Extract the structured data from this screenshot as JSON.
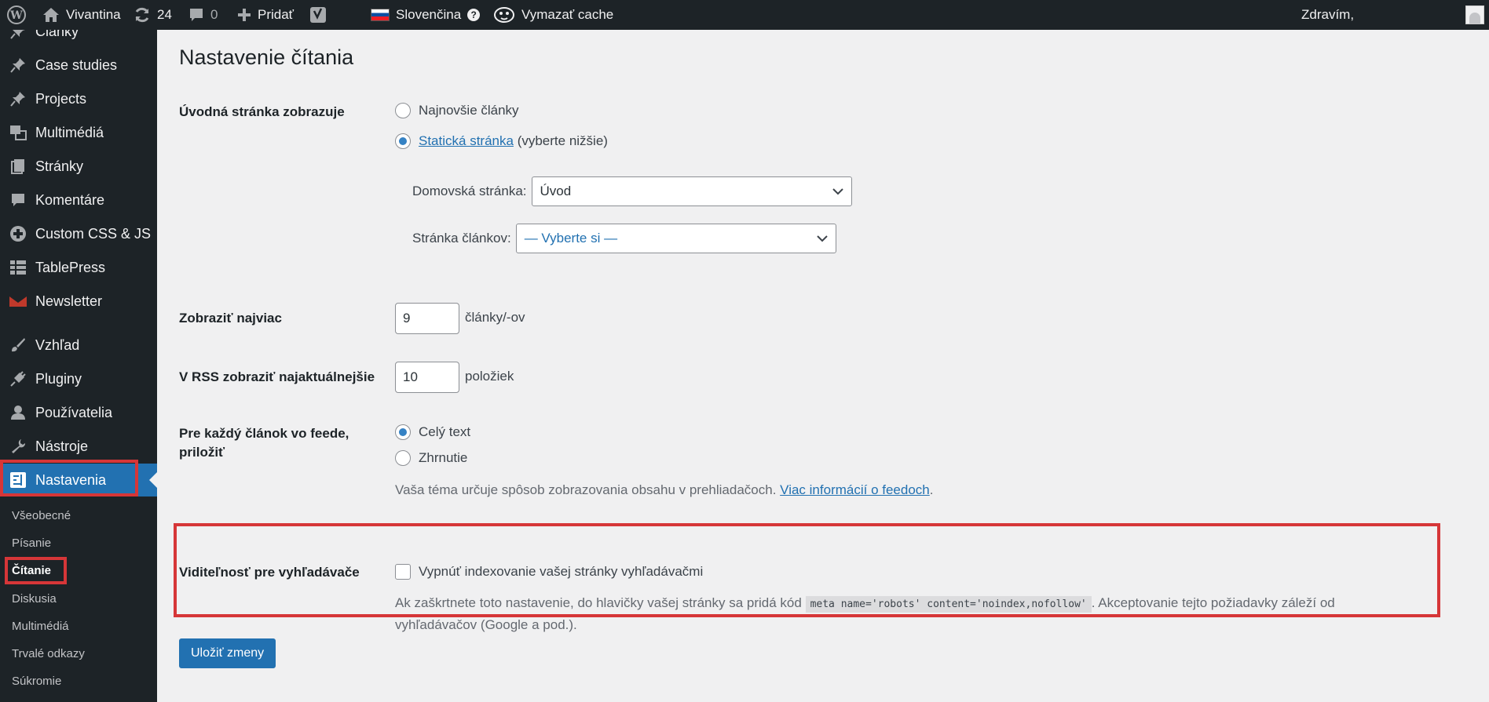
{
  "adminbar": {
    "site_name": "Vivantina",
    "updates_count": "24",
    "comments_count": "0",
    "new_label": "Pridať",
    "language_label": "Slovenčina",
    "cache_label": "Vymazať cache",
    "greeting": "Zdravím,"
  },
  "sidebar": {
    "items": [
      {
        "label": "Články",
        "icon": "pin-icon"
      },
      {
        "label": "Case studies",
        "icon": "pin-icon"
      },
      {
        "label": "Projects",
        "icon": "pin-icon"
      },
      {
        "label": "Multimédiá",
        "icon": "media-icon"
      },
      {
        "label": "Stránky",
        "icon": "page-icon"
      },
      {
        "label": "Komentáre",
        "icon": "comment-icon"
      },
      {
        "label": "Custom CSS & JS",
        "icon": "plus-circle-icon"
      },
      {
        "label": "TablePress",
        "icon": "table-icon"
      },
      {
        "label": "Newsletter",
        "icon": "envelope-icon"
      },
      {
        "label": "Vzhľad",
        "icon": "brush-icon"
      },
      {
        "label": "Pluginy",
        "icon": "plug-icon"
      },
      {
        "label": "Používatelia",
        "icon": "user-icon"
      },
      {
        "label": "Nástroje",
        "icon": "wrench-icon"
      },
      {
        "label": "Nastavenia",
        "icon": "settings-icon"
      }
    ],
    "submenu": [
      "Všeobecné",
      "Písanie",
      "Čítanie",
      "Diskusia",
      "Multimédiá",
      "Trvalé odkazy",
      "Súkromie"
    ]
  },
  "main": {
    "title": "Nastavenie čítania",
    "front_page": {
      "label": "Úvodná stránka zobrazuje",
      "option_latest": "Najnovšie články",
      "option_static_link": "Statická stránka",
      "option_static_suffix": "(vyberte nižšie)",
      "selected": "static",
      "homepage_label": "Domovská stránka:",
      "homepage_value": "Úvod",
      "posts_page_label": "Stránka článkov:",
      "posts_page_value": "— Vyberte si —"
    },
    "posts_per_page": {
      "label": "Zobraziť najviac",
      "value": "9",
      "suffix": "články/-ov"
    },
    "rss_items": {
      "label": "V RSS zobraziť najaktuálnejšie",
      "value": "10",
      "suffix": "položiek"
    },
    "feed": {
      "label_line1": "Pre každý článok vo feede,",
      "label_line2": "priložiť",
      "option_full": "Celý text",
      "option_summary": "Zhrnutie",
      "selected": "full",
      "desc_text": "Vaša téma určuje spôsob zobrazovania obsahu v prehliadačoch.",
      "desc_link": "Viac informácií o feedoch",
      "desc_end": "."
    },
    "search_visibility": {
      "label": "Viditeľnosť pre vyhľadávače",
      "checkbox_label": "Vypnúť indexovanie vašej stránky vyhľadávačmi",
      "checked": false,
      "desc_before": "Ak zaškrtnete toto nastavenie, do hlavičky vašej stránky sa pridá kód",
      "desc_code": "meta name='robots' content='noindex,nofollow'",
      "desc_after": ". Akceptovanie tejto požiadavky záleží od",
      "desc_line2": "vyhľadávačov (Google a pod.)."
    },
    "save_button": "Uložiť zmeny"
  },
  "colors": {
    "adminbar_bg": "#1d2327",
    "accent": "#2271b1",
    "highlight_box": "#d63638"
  }
}
